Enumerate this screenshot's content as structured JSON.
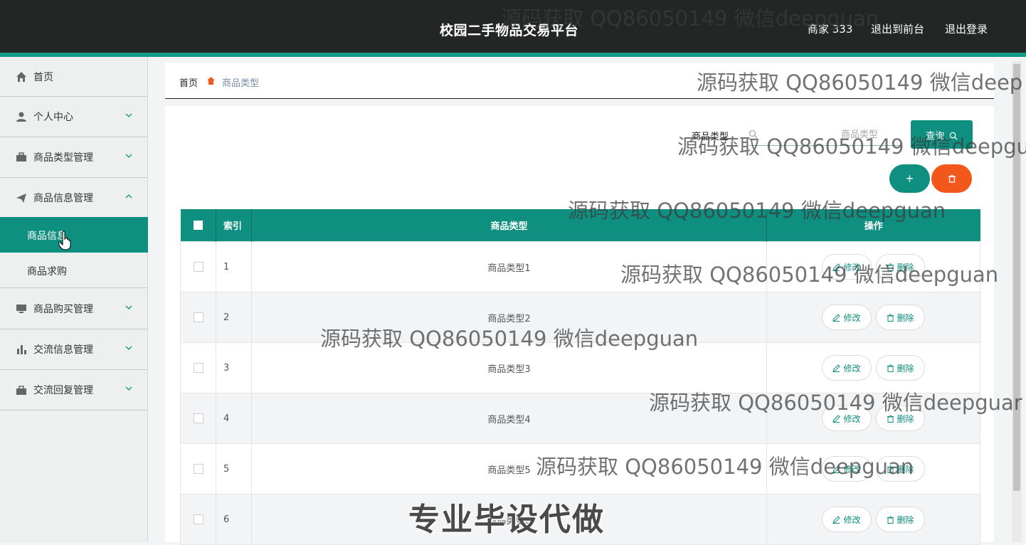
{
  "header": {
    "title": "校园二手物品交易平台",
    "user": "商家 333",
    "to_front": "退出到前台",
    "logout": "退出登录"
  },
  "sidebar": {
    "items": [
      {
        "label": "首页",
        "icon": "home-icon"
      },
      {
        "label": "个人中心",
        "icon": "user-icon"
      },
      {
        "label": "商品类型管理",
        "icon": "briefcase-icon"
      },
      {
        "label": "商品信息管理",
        "icon": "send-icon"
      },
      {
        "label": "商品购买管理",
        "icon": "monitor-icon"
      },
      {
        "label": "交流信息管理",
        "icon": "bar-chart-icon"
      },
      {
        "label": "交流回复管理",
        "icon": "bag-icon"
      }
    ],
    "subitems": [
      {
        "label": "商品信息",
        "active": true
      },
      {
        "label": "商品求购",
        "active": false
      }
    ]
  },
  "breadcrumb": {
    "home": "首页",
    "current": "商品类型"
  },
  "search": {
    "label": "商品类型",
    "placeholder": "商品类型",
    "button": "查询"
  },
  "actions": {
    "add": "+"
  },
  "table": {
    "headers": [
      "索引",
      "商品类型",
      "操作"
    ],
    "rows": [
      {
        "index": "1",
        "type": "商品类型1"
      },
      {
        "index": "2",
        "type": "商品类型2"
      },
      {
        "index": "3",
        "type": "商品类型3"
      },
      {
        "index": "4",
        "type": "商品类型4"
      },
      {
        "index": "5",
        "type": "商品类型5"
      },
      {
        "index": "6",
        "type": "商品类型6"
      }
    ],
    "edit_label": "修改",
    "delete_label": "删除"
  },
  "watermarks": {
    "text": "源码获取 QQ86050149 微信deepguan",
    "text_cut1": "源码获取 QQ86050149 微信deep",
    "text_cut2": "源码获取 QQ86050149 微信deepgu",
    "text_cut3": "源码获取 QQ86050149 微信deepguar",
    "big": "专业毕设代做"
  },
  "colors": {
    "accent": "#0f8f80",
    "danger": "#f2571c",
    "header_bg": "#232624"
  }
}
